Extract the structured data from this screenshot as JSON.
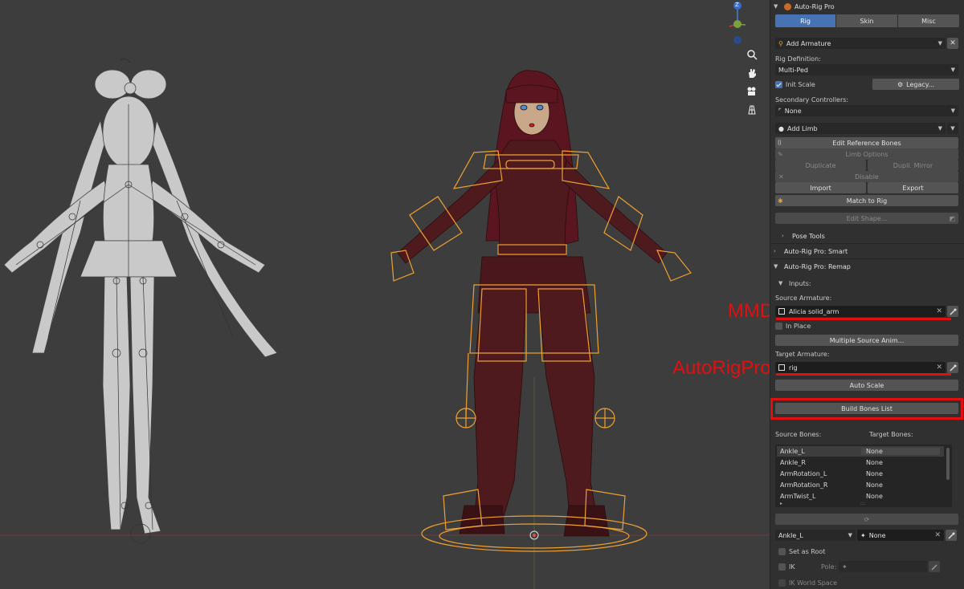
{
  "viewport": {
    "gizmo_axis": "Z",
    "annotations": {
      "mmd": "MMD",
      "autorigpro": "AutoRigPro"
    }
  },
  "sidebar": {
    "addon_title": "Auto-Rig Pro",
    "tabs": [
      {
        "label": "Rig",
        "active": true
      },
      {
        "label": "Skin",
        "active": false
      },
      {
        "label": "Misc",
        "active": false
      }
    ],
    "add_armature": "Add Armature",
    "rig_definition_label": "Rig Definition:",
    "rig_definition_value": "Multi-Ped",
    "init_scale": "Init Scale",
    "init_scale_checked": true,
    "legacy_button": "Legacy...",
    "secondary_controllers_label": "Secondary Controllers:",
    "secondary_controllers_value": "None",
    "add_limb": "Add Limb",
    "edit_reference_bones": "Edit Reference Bones",
    "limb_options": "Limb Options",
    "duplicate": "Duplicate",
    "dupli_mirror": "Dupli. Mirror",
    "disable": "Disable",
    "import": "Import",
    "export": "Export",
    "match_to_rig": "Match to Rig",
    "edit_shape": "Edit Shape...",
    "pose_tools": "Pose Tools",
    "smart_panel": "Auto-Rig Pro: Smart",
    "remap_panel": "Auto-Rig Pro: Remap",
    "inputs_label": "Inputs:",
    "source_armature_label": "Source Armature:",
    "source_armature_value": "Alicia solid_arm",
    "in_place": "In Place",
    "multiple_source_anim": "Multiple Source Anim...",
    "target_armature_label": "Target Armature:",
    "target_armature_value": "rig",
    "auto_scale": "Auto Scale",
    "build_bones_list": "Build Bones List",
    "source_bones_label": "Source Bones:",
    "target_bones_label": "Target Bones:",
    "bones": [
      {
        "source": "Ankle_L",
        "target": "None"
      },
      {
        "source": "Ankle_R",
        "target": "None"
      },
      {
        "source": "ArmRotation_L",
        "target": "None"
      },
      {
        "source": "ArmRotation_R",
        "target": "None"
      },
      {
        "source": "ArmTwist_L",
        "target": "None"
      }
    ],
    "selected_source_bone": "Ankle_L",
    "selected_target_bone": "None",
    "set_as_root": "Set as Root",
    "ik": "IK",
    "pole_label": "Pole:",
    "ik_world_space": "IK World Space",
    "colors": {
      "accent": "#4772b3",
      "annotation": "#e01010",
      "bone_orange": "#f0a030"
    }
  }
}
